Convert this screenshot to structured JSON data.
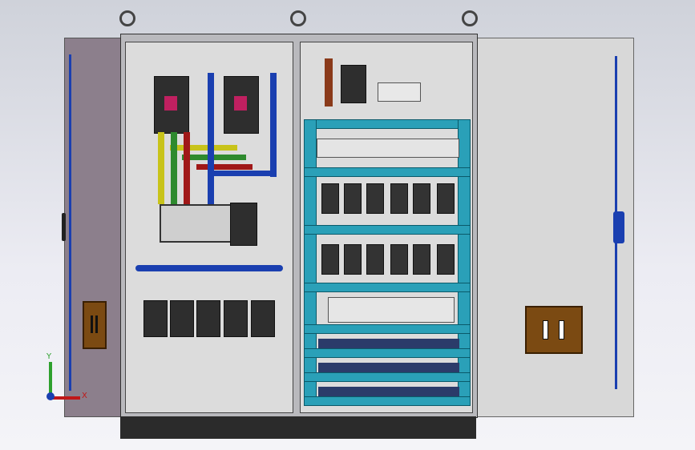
{
  "axes": {
    "y_label": "Y",
    "x_label": "X"
  },
  "colors": {
    "busbar_yellow": "#c8c31a",
    "busbar_green": "#2e8a2e",
    "busbar_red": "#a01818",
    "busbar_blue": "#1a3fb0",
    "din_rail": "#2aa0b8",
    "door_handle": "#7b4a12",
    "cabinet_body": "#b9b9bd"
  },
  "icons": {
    "lifting_eye": "lifting-eye-icon",
    "axis_triad": "axis-triad-icon"
  }
}
